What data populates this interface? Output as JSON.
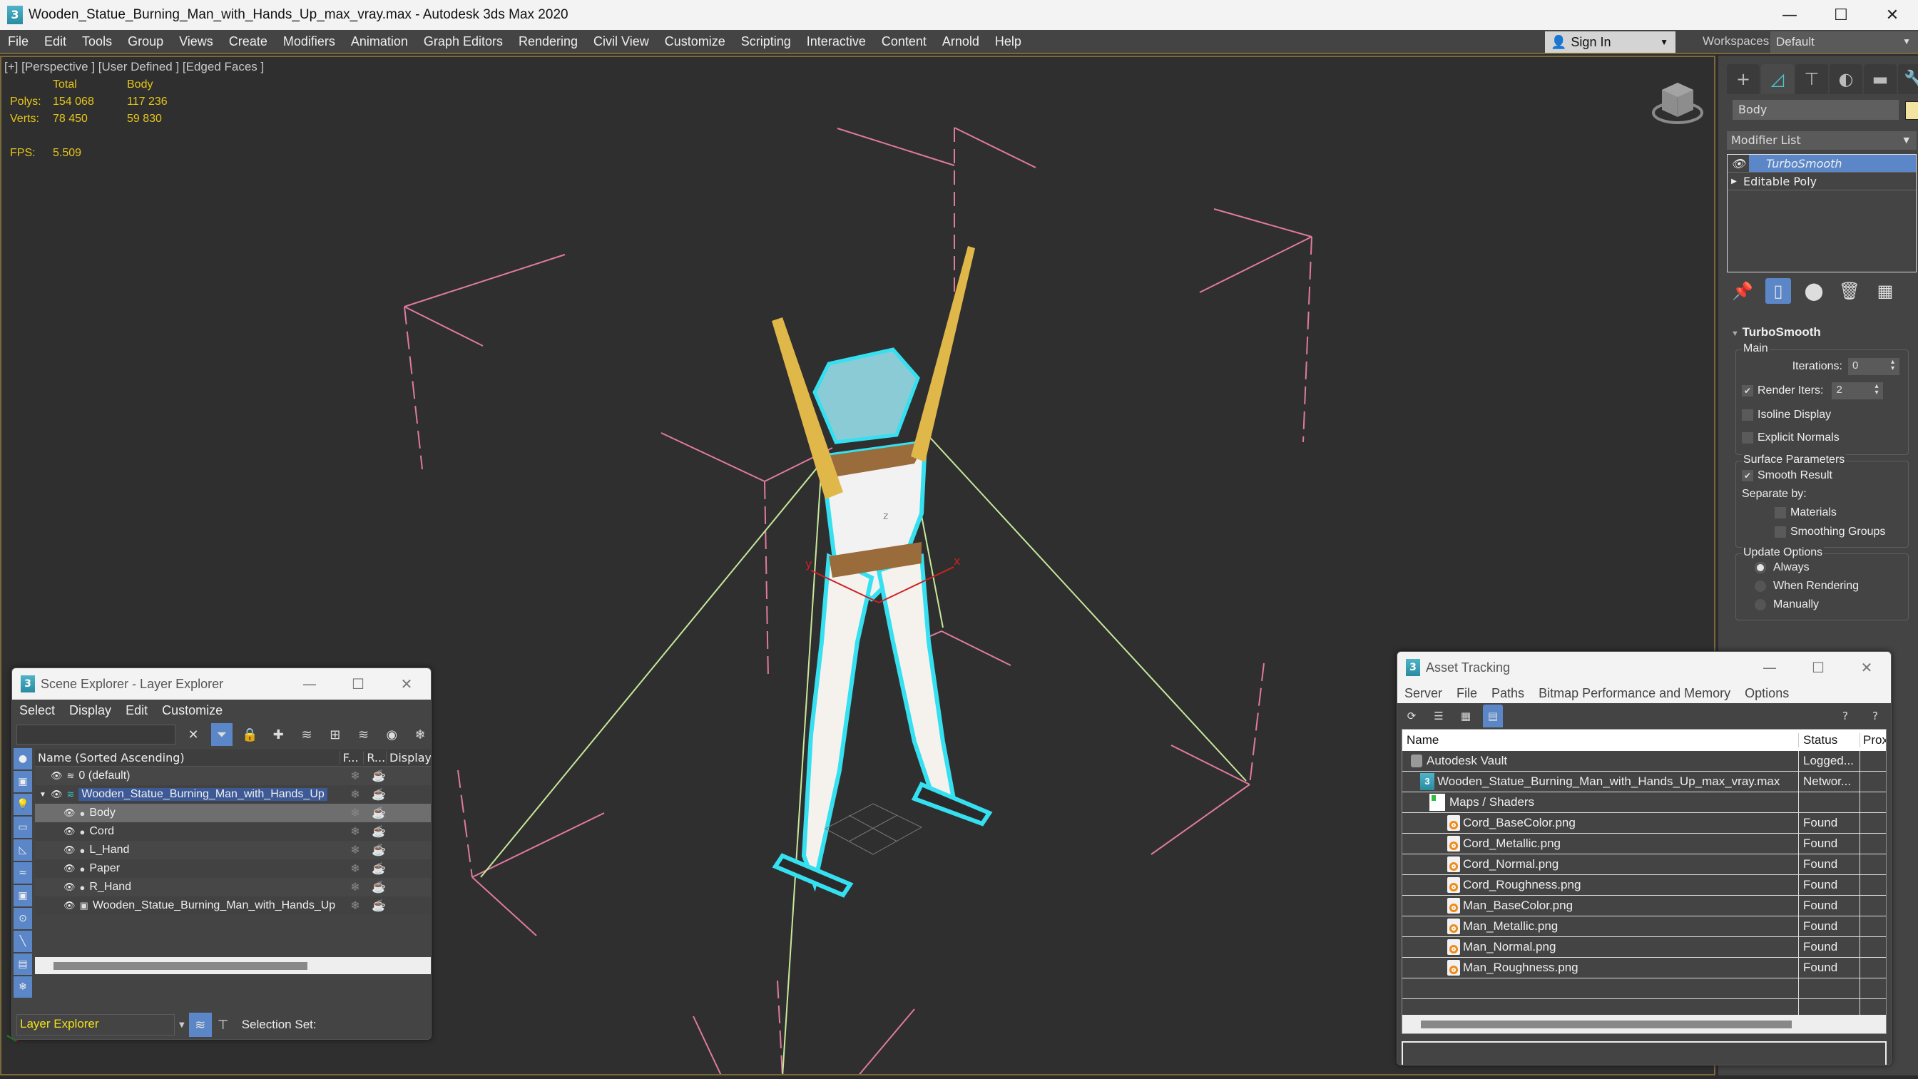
{
  "window": {
    "title": "Wooden_Statue_Burning_Man_with_Hands_Up_max_vray.max - Autodesk 3ds Max 2020",
    "app_icon": "3",
    "controls": [
      "minimize-icon",
      "maximize-icon",
      "close-icon"
    ]
  },
  "menubar": {
    "items": [
      "File",
      "Edit",
      "Tools",
      "Group",
      "Views",
      "Create",
      "Modifiers",
      "Animation",
      "Graph Editors",
      "Rendering",
      "Civil View",
      "Customize",
      "Scripting",
      "Interactive",
      "Content",
      "Arnold",
      "Help"
    ],
    "sign_in": "Sign In",
    "workspaces_label": "Workspaces:",
    "workspace_value": "Default"
  },
  "viewport": {
    "label": "[+] [Perspective ] [User Defined ] [Edged Faces ]",
    "stats": {
      "headers": [
        "",
        "Total",
        "Body"
      ],
      "rows": [
        {
          "label": "Polys:",
          "total": "154 068",
          "selected": "117 236"
        },
        {
          "label": "Verts:",
          "total": "78 450",
          "selected": "59 830"
        }
      ],
      "fps_label": "FPS:",
      "fps_value": "5.509"
    },
    "gizmo_labels": {
      "x": "x",
      "y": "y",
      "z": "z"
    },
    "colors": {
      "stat_text": "#e6c619",
      "selection_outline": "#35e0f0",
      "hands": "#e0b84a",
      "helper_lines": "#e07aa0",
      "cords": "#c8e89a"
    }
  },
  "command_panel": {
    "tabs": [
      "create-icon",
      "modify-icon",
      "hierarchy-icon",
      "motion-icon",
      "display-icon",
      "utilities-icon"
    ],
    "object_name": "Body",
    "object_color": "#f2e3a0",
    "modifier_list_label": "Modifier List",
    "stack": [
      {
        "label": "TurboSmooth",
        "selected": true
      },
      {
        "label": "Editable Poly",
        "selected": false
      }
    ],
    "rollout": {
      "title": "TurboSmooth",
      "main_group": "Main",
      "iterations_label": "Iterations:",
      "iterations_value": "0",
      "render_iters_label": "Render Iters:",
      "render_iters_value": "2",
      "render_iters_checked": true,
      "isoline_display_label": "Isoline Display",
      "isoline_display_checked": false,
      "explicit_normals_label": "Explicit Normals",
      "explicit_normals_checked": false,
      "surface_group": "Surface Parameters",
      "smooth_result_label": "Smooth Result",
      "smooth_result_checked": true,
      "separate_by_label": "Separate by:",
      "materials_label": "Materials",
      "materials_checked": false,
      "smoothing_groups_label": "Smoothing Groups",
      "smoothing_groups_checked": false,
      "update_group": "Update Options",
      "update_options": [
        "Always",
        "When Rendering",
        "Manually"
      ],
      "update_selected": "Always"
    }
  },
  "scene_explorer": {
    "title": "Scene Explorer - Layer Explorer",
    "menu": [
      "Select",
      "Display",
      "Edit",
      "Customize"
    ],
    "search_value": "",
    "columns": [
      "Name (Sorted Ascending)",
      "F...",
      "R...",
      "Display"
    ],
    "rows": [
      {
        "name": "0 (default)",
        "type": "layer",
        "level": 0
      },
      {
        "name": "Wooden_Statue_Burning_Man_with_Hands_Up",
        "type": "layer",
        "level": 0,
        "expanded": true,
        "highlighted": true
      },
      {
        "name": "Body",
        "type": "object",
        "level": 1,
        "selected": true
      },
      {
        "name": "Cord",
        "type": "object",
        "level": 1
      },
      {
        "name": "L_Hand",
        "type": "object",
        "level": 1
      },
      {
        "name": "Paper",
        "type": "object",
        "level": 1
      },
      {
        "name": "R_Hand",
        "type": "object",
        "level": 1
      },
      {
        "name": "Wooden_Statue_Burning_Man_with_Hands_Up",
        "type": "group",
        "level": 1
      }
    ],
    "explorer_mode": "Layer Explorer",
    "selection_set_label": "Selection Set:"
  },
  "asset_tracking": {
    "title": "Asset Tracking",
    "menu": [
      "Server",
      "File",
      "Paths",
      "Bitmap Performance and Memory",
      "Options"
    ],
    "columns": [
      "Name",
      "Status",
      "Prox"
    ],
    "rows": [
      {
        "name": "Autodesk Vault",
        "status": "Logged...",
        "icon": "vault",
        "level": 0
      },
      {
        "name": "Wooden_Statue_Burning_Man_with_Hands_Up_max_vray.max",
        "status": "Networ...",
        "icon": "max",
        "level": 1
      },
      {
        "name": "Maps / Shaders",
        "status": "",
        "icon": "maps",
        "level": 2
      },
      {
        "name": "Cord_BaseColor.png",
        "status": "Found",
        "icon": "png",
        "level": 3
      },
      {
        "name": "Cord_Metallic.png",
        "status": "Found",
        "icon": "png",
        "level": 3
      },
      {
        "name": "Cord_Normal.png",
        "status": "Found",
        "icon": "png",
        "level": 3
      },
      {
        "name": "Cord_Roughness.png",
        "status": "Found",
        "icon": "png",
        "level": 3
      },
      {
        "name": "Man_BaseColor.png",
        "status": "Found",
        "icon": "png",
        "level": 3
      },
      {
        "name": "Man_Metallic.png",
        "status": "Found",
        "icon": "png",
        "level": 3
      },
      {
        "name": "Man_Normal.png",
        "status": "Found",
        "icon": "png",
        "level": 3
      },
      {
        "name": "Man_Roughness.png",
        "status": "Found",
        "icon": "png",
        "level": 3
      }
    ]
  }
}
